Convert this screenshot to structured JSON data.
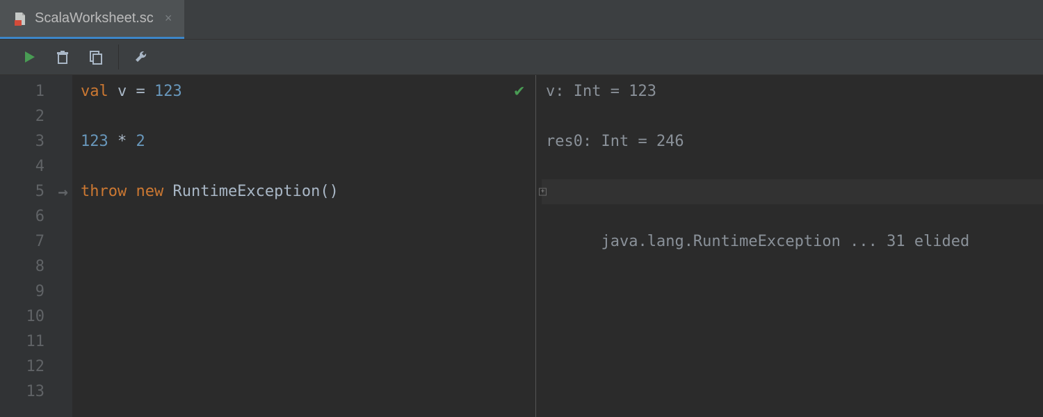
{
  "tab": {
    "filename": "ScalaWorksheet.sc"
  },
  "icons": {
    "run": "run-icon",
    "clear": "trash-icon",
    "copy": "copy-icon",
    "settings": "wrench-icon"
  },
  "editor": {
    "line_count": 13,
    "exec_marker_line": 5,
    "code": {
      "l1": {
        "kw": "val",
        "ident": " v ",
        "op": "= ",
        "num": "123"
      },
      "l3": {
        "num1": "123",
        "op": " * ",
        "num2": "2"
      },
      "l5": {
        "kw1": "throw ",
        "kw2": "new ",
        "ident": "RuntimeException()"
      }
    },
    "status": "ok"
  },
  "output": {
    "l1": "v: Int = 123",
    "l3": "res0: Int = 246",
    "l5": "java.lang.RuntimeException ... 31 elided"
  },
  "colors": {
    "bg": "#2b2b2b",
    "panel": "#3c3f41",
    "gutter": "#313335",
    "keyword": "#cc7832",
    "number": "#6897bb",
    "text": "#a9b7c6",
    "tab_underline": "#3c86c9",
    "ok": "#499c54"
  }
}
